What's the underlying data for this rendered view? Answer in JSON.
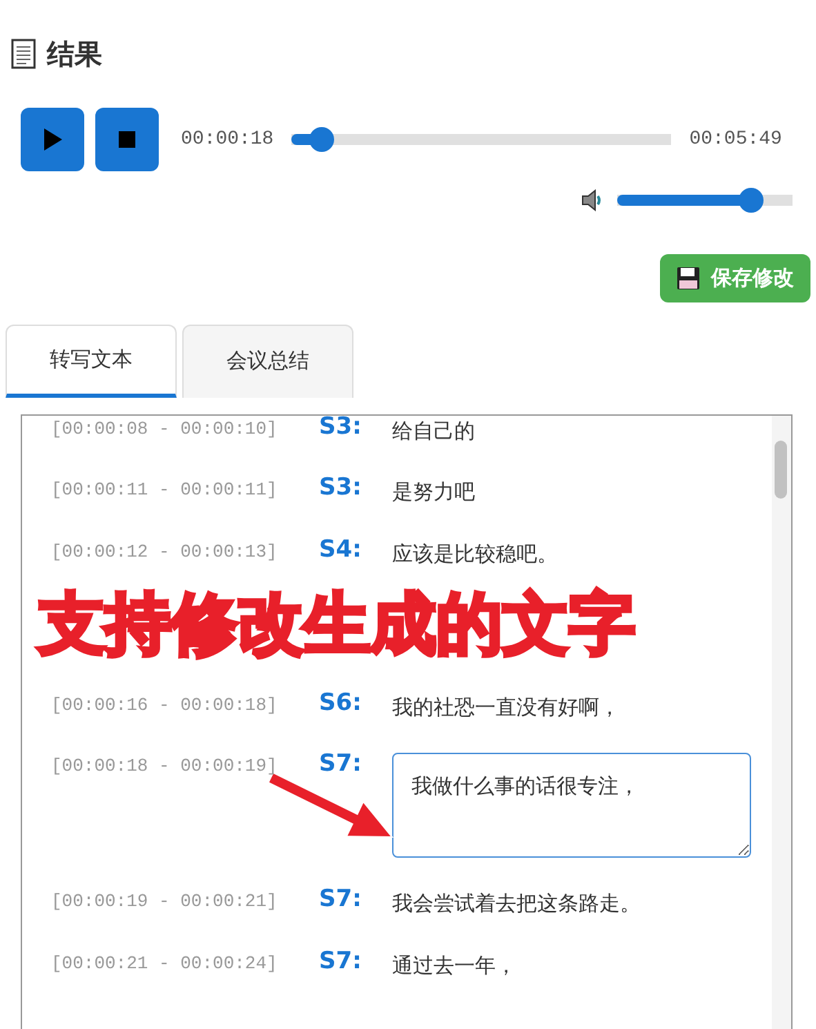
{
  "title": "结果",
  "player": {
    "current_time": "00:00:18",
    "total_time": "00:05:49",
    "progress": {
      "level": 0.08
    },
    "volume": {
      "level": 0.76
    }
  },
  "save_button": "保存修改",
  "tabs": [
    {
      "label": "转写文本",
      "selected": true
    },
    {
      "label": "会议总结",
      "selected": false
    }
  ],
  "transcript": [
    {
      "time": "[00:00:08 - 00:00:10]",
      "speaker": "S3:",
      "text": "给自己的",
      "editing": false
    },
    {
      "time": "[00:00:11 - 00:00:11]",
      "speaker": "S3:",
      "text": "是努力吧",
      "editing": false
    },
    {
      "time": "[00:00:12 - 00:00:13]",
      "speaker": "S4:",
      "text": "应该是比较稳吧。",
      "editing": false
    },
    {
      "kind": "caption",
      "text": "支持修改生成的文字"
    },
    {
      "time": "[00:00:16 - 00:00:18]",
      "speaker": "S6:",
      "text": "我的社恐一直没有好啊，",
      "editing": false
    },
    {
      "time": "[00:00:18 - 00:00:19]",
      "speaker": "S7:",
      "text": "我做什么事的话很专注，",
      "editing": true
    },
    {
      "time": "[00:00:19 - 00:00:21]",
      "speaker": "S7:",
      "text": "我会尝试着去把这条路走。",
      "editing": false
    },
    {
      "time": "[00:00:21 - 00:00:24]",
      "speaker": "S7:",
      "text": "通过去一年，",
      "editing": false
    }
  ]
}
